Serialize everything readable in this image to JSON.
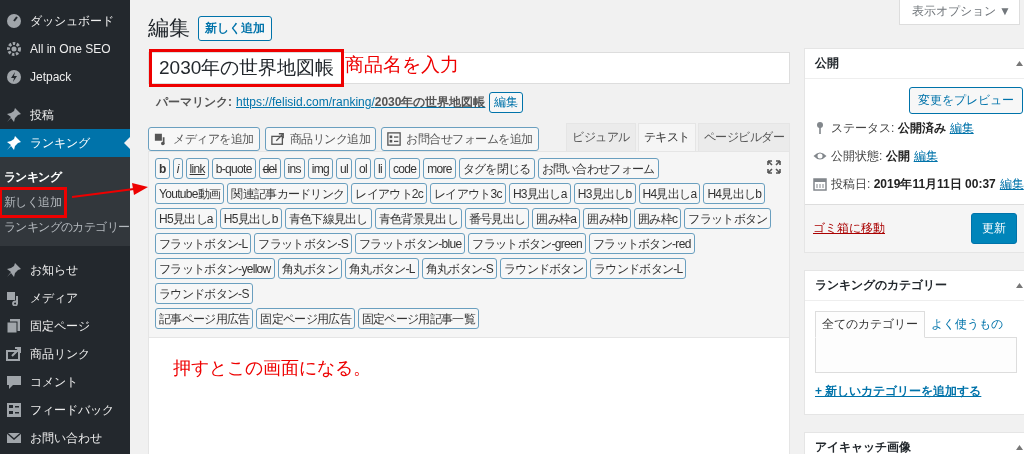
{
  "sidebar": {
    "items": [
      {
        "label": "ダッシュボード",
        "selected": false
      },
      {
        "label": "All in One SEO",
        "selected": false
      },
      {
        "label": "Jetpack",
        "selected": false
      },
      {
        "label": "投稿",
        "selected": false
      },
      {
        "label": "ランキング",
        "selected": true,
        "children": [
          {
            "label": "ランキング",
            "selected": true,
            "highlighted": false
          },
          {
            "label": "新しく追加",
            "selected": false,
            "highlighted": true
          },
          {
            "label": "ランキングのカテゴリー",
            "selected": false,
            "highlighted": false
          }
        ]
      },
      {
        "label": "お知らせ",
        "selected": false
      },
      {
        "label": "メディア",
        "selected": false
      },
      {
        "label": "固定ページ",
        "selected": false
      },
      {
        "label": "商品リンク",
        "selected": false
      },
      {
        "label": "コメント",
        "selected": false
      },
      {
        "label": "フィードバック",
        "selected": false
      },
      {
        "label": "お問い合わせ",
        "selected": false
      }
    ]
  },
  "screen_options": "表示オプション ▼",
  "heading": "編集",
  "add_new_button": "新しく追加",
  "title_field": {
    "value": "2030年の世界地図帳",
    "highlighted": true
  },
  "permalink": {
    "label": "パーマリンク:",
    "url_base": "https://felisid.com/ranking/",
    "slug": "2030年の世界地図帳",
    "edit_button": "編集"
  },
  "media_buttons": [
    "メディアを追加",
    "商品リンク追加",
    "お問合せフォームを追加"
  ],
  "editor_tabs": [
    {
      "label": "ビジュアル",
      "selected": false
    },
    {
      "label": "テキスト",
      "selected": true
    },
    {
      "label": "ページビルダー",
      "selected": false
    }
  ],
  "toolbar_rows": [
    [
      {
        "label": "b",
        "kind": "bold"
      },
      {
        "label": "i",
        "kind": "italic"
      },
      {
        "label": "link",
        "kind": "link"
      },
      {
        "label": "b-quote",
        "kind": "plain"
      },
      {
        "label": "del",
        "kind": "strike"
      },
      {
        "label": "ins",
        "kind": "plain"
      },
      {
        "label": "img",
        "kind": "plain"
      },
      {
        "label": "ul",
        "kind": "plain"
      },
      {
        "label": "ol",
        "kind": "plain"
      },
      {
        "label": "li",
        "kind": "plain"
      },
      {
        "label": "code",
        "kind": "plain"
      },
      {
        "label": "more",
        "kind": "plain"
      },
      {
        "label": "タグを閉じる",
        "kind": "plain"
      },
      {
        "label": "お問い合わせフォーム",
        "kind": "plain"
      }
    ],
    [
      {
        "label": "Youtube動画",
        "kind": "plain"
      },
      {
        "label": "関連記事カードリンク",
        "kind": "plain"
      },
      {
        "label": "レイアウト2c",
        "kind": "plain"
      },
      {
        "label": "レイアウト3c",
        "kind": "plain"
      },
      {
        "label": "H3見出しa",
        "kind": "plain"
      },
      {
        "label": "H3見出しb",
        "kind": "plain"
      },
      {
        "label": "H4見出しa",
        "kind": "plain"
      },
      {
        "label": "H4見出しb",
        "kind": "plain"
      }
    ],
    [
      {
        "label": "H5見出しa",
        "kind": "plain"
      },
      {
        "label": "H5見出しb",
        "kind": "plain"
      },
      {
        "label": "青色下線見出し",
        "kind": "plain"
      },
      {
        "label": "青色背景見出し",
        "kind": "plain"
      },
      {
        "label": "番号見出し",
        "kind": "plain"
      },
      {
        "label": "囲み枠a",
        "kind": "plain"
      },
      {
        "label": "囲み枠b",
        "kind": "plain"
      },
      {
        "label": "囲み枠c",
        "kind": "plain"
      },
      {
        "label": "フラットボタン",
        "kind": "plain"
      }
    ],
    [
      {
        "label": "フラットボタン-L",
        "kind": "plain"
      },
      {
        "label": "フラットボタン-S",
        "kind": "plain"
      },
      {
        "label": "フラットボタン-blue",
        "kind": "plain"
      },
      {
        "label": "フラットボタン-green",
        "kind": "plain"
      },
      {
        "label": "フラットボタン-red",
        "kind": "plain"
      }
    ],
    [
      {
        "label": "フラットボタン-yellow",
        "kind": "plain"
      },
      {
        "label": "角丸ボタン",
        "kind": "plain"
      },
      {
        "label": "角丸ボタン-L",
        "kind": "plain"
      },
      {
        "label": "角丸ボタン-S",
        "kind": "plain"
      },
      {
        "label": "ラウンドボタン",
        "kind": "plain"
      },
      {
        "label": "ラウンドボタン-L",
        "kind": "plain"
      },
      {
        "label": "ラウンドボタン-S",
        "kind": "plain"
      }
    ],
    [
      {
        "label": "記事ページ用広告",
        "kind": "plain"
      },
      {
        "label": "固定ページ用広告",
        "kind": "plain"
      },
      {
        "label": "固定ページ用記事一覧",
        "kind": "plain"
      }
    ]
  ],
  "publish_box": {
    "title": "公開",
    "preview_button": "変更をプレビュー",
    "rows": [
      {
        "label": "ステータス:",
        "value": "公開済み",
        "link": "編集"
      },
      {
        "label": "公開状態:",
        "value": "公開",
        "link": "編集"
      },
      {
        "label": "投稿日:",
        "value": "2019年11月11日 00:37",
        "link": "編集"
      }
    ],
    "trash_link": "ゴミ箱に移動",
    "update_button": "更新"
  },
  "category_box": {
    "title": "ランキングのカテゴリー",
    "tabs": [
      {
        "label": "全てのカテゴリー",
        "selected": true
      },
      {
        "label": "よく使うもの",
        "selected": false
      }
    ],
    "add_link": "+ 新しいカテゴリーを追加する"
  },
  "featured_image_box": {
    "title": "アイキャッチ画像"
  },
  "annotations": [
    {
      "kind": "title_note",
      "text": "商品名を入力"
    },
    {
      "kind": "menu_note",
      "text": "押すとこの画面になる。"
    }
  ]
}
